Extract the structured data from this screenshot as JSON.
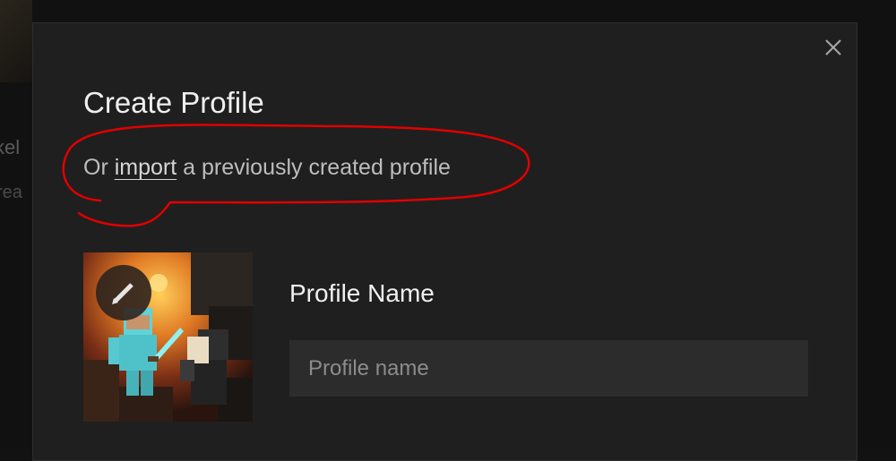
{
  "background": {
    "partial_text_1": "kel",
    "partial_text_2": "rea"
  },
  "modal": {
    "title": "Create Profile",
    "subtitle_prefix": "Or ",
    "import_link": "import",
    "subtitle_suffix": " a previously created profile",
    "close_icon": "close-icon",
    "profile_name_label": "Profile Name",
    "profile_name_placeholder": "Profile name",
    "profile_name_value": "",
    "avatar_edit_icon": "pencil-icon"
  },
  "colors": {
    "modal_bg": "#1f1f1f",
    "input_bg": "#2c2c2c",
    "annotation_red": "#e00000"
  }
}
